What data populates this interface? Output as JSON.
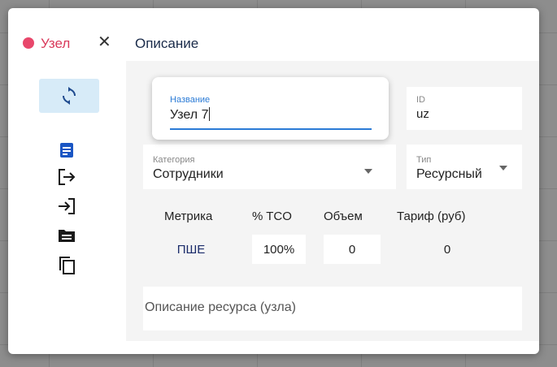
{
  "header": {
    "node_title": "Узел",
    "tab_title": "Описание",
    "accent_color": "#e8476b"
  },
  "sidebar": {
    "icons": [
      "sync-icon",
      "document-icon",
      "logout-icon",
      "login-icon",
      "folder-icon",
      "copy-icon"
    ]
  },
  "form": {
    "name_label": "Название",
    "name_value": "Узел 7",
    "id_label": "ID",
    "id_value": "uz",
    "category_label": "Категория",
    "category_value": "Сотрудники",
    "type_label": "Тип",
    "type_value": "Ресурсный"
  },
  "metrics": {
    "headers": [
      "Метрика",
      "% TCO",
      "Объем",
      "Тариф (руб)"
    ],
    "row": {
      "metric": "ПШЕ",
      "tco": "100%",
      "volume": "0",
      "tariff": "0"
    }
  },
  "description": {
    "placeholder": "Описание ресурса (узла)"
  }
}
